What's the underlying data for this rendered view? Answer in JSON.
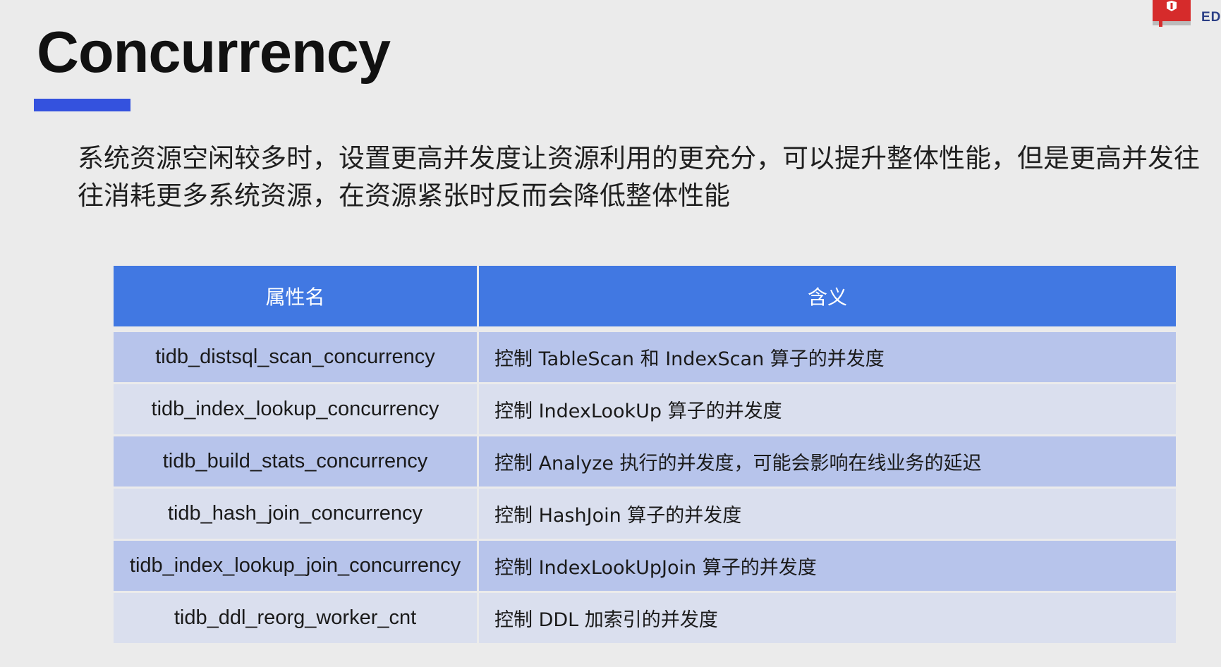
{
  "slide": {
    "title": "Concurrency",
    "description": "系统资源空闲较多时，设置更高并发度让资源利用的更充分，可以提升整体性能，但是更高并发往往消耗更多系统资源，在资源紧张时反而会降低整体性能",
    "logo_text": "ED",
    "accent_color": "#3452de"
  },
  "table": {
    "headers": [
      "属性名",
      "含义"
    ],
    "header_color": "#4178e2",
    "rows": [
      {
        "name": "tidb_distsql_scan_concurrency",
        "meaning": "控制 TableScan 和 IndexScan 算子的并发度"
      },
      {
        "name": "tidb_index_lookup_concurrency",
        "meaning": "控制 IndexLookUp 算子的并发度"
      },
      {
        "name": "tidb_build_stats_concurrency",
        "meaning": "控制 Analyze 执行的并发度，可能会影响在线业务的延迟"
      },
      {
        "name": "tidb_hash_join_concurrency",
        "meaning": "控制 HashJoin 算子的并发度"
      },
      {
        "name": "tidb_index_lookup_join_concurrency",
        "meaning": "控制 IndexLookUpJoin 算子的并发度"
      },
      {
        "name": "tidb_ddl_reorg_worker_cnt",
        "meaning": "控制 DDL 加索引的并发度"
      }
    ]
  }
}
